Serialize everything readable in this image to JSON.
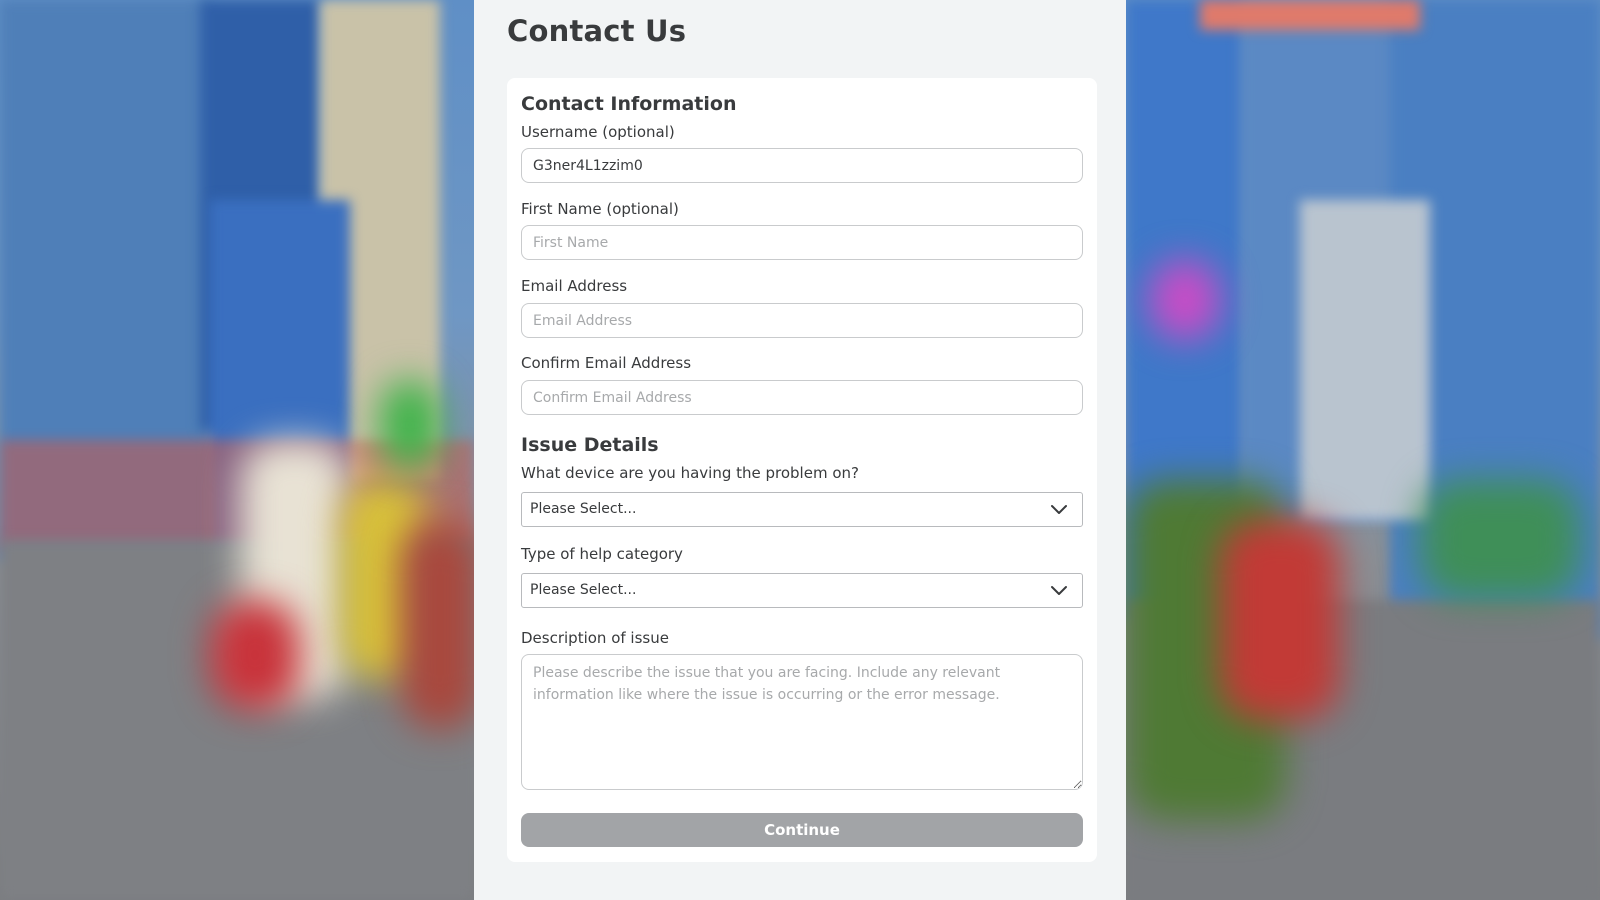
{
  "page": {
    "title": "Contact Us"
  },
  "contact_info": {
    "heading": "Contact Information",
    "username": {
      "label": "Username (optional)",
      "value": "G3ner4L1zzim0",
      "placeholder": ""
    },
    "first_name": {
      "label": "First Name (optional)",
      "value": "",
      "placeholder": "First Name"
    },
    "email": {
      "label": "Email Address",
      "value": "",
      "placeholder": "Email Address"
    },
    "confirm_email": {
      "label": "Confirm Email Address",
      "value": "",
      "placeholder": "Confirm Email Address"
    }
  },
  "issue_details": {
    "heading": "Issue Details",
    "device": {
      "label": "What device are you having the problem on?",
      "selected": "Please Select..."
    },
    "help_category": {
      "label": "Type of help category",
      "selected": "Please Select..."
    },
    "description": {
      "label": "Description of issue",
      "value": "",
      "placeholder": "Please describe the issue that you are facing. Include any relevant information like where the issue is occurring or the error message."
    }
  },
  "actions": {
    "continue_label": "Continue"
  },
  "colors": {
    "panel_background": "#f2f4f5",
    "card_background": "#ffffff",
    "text": "#393b3d",
    "placeholder": "#a7a9ab",
    "continue_disabled": "#a2a4a7"
  },
  "icons": {
    "select_indicator": "chevron-down-icon"
  }
}
